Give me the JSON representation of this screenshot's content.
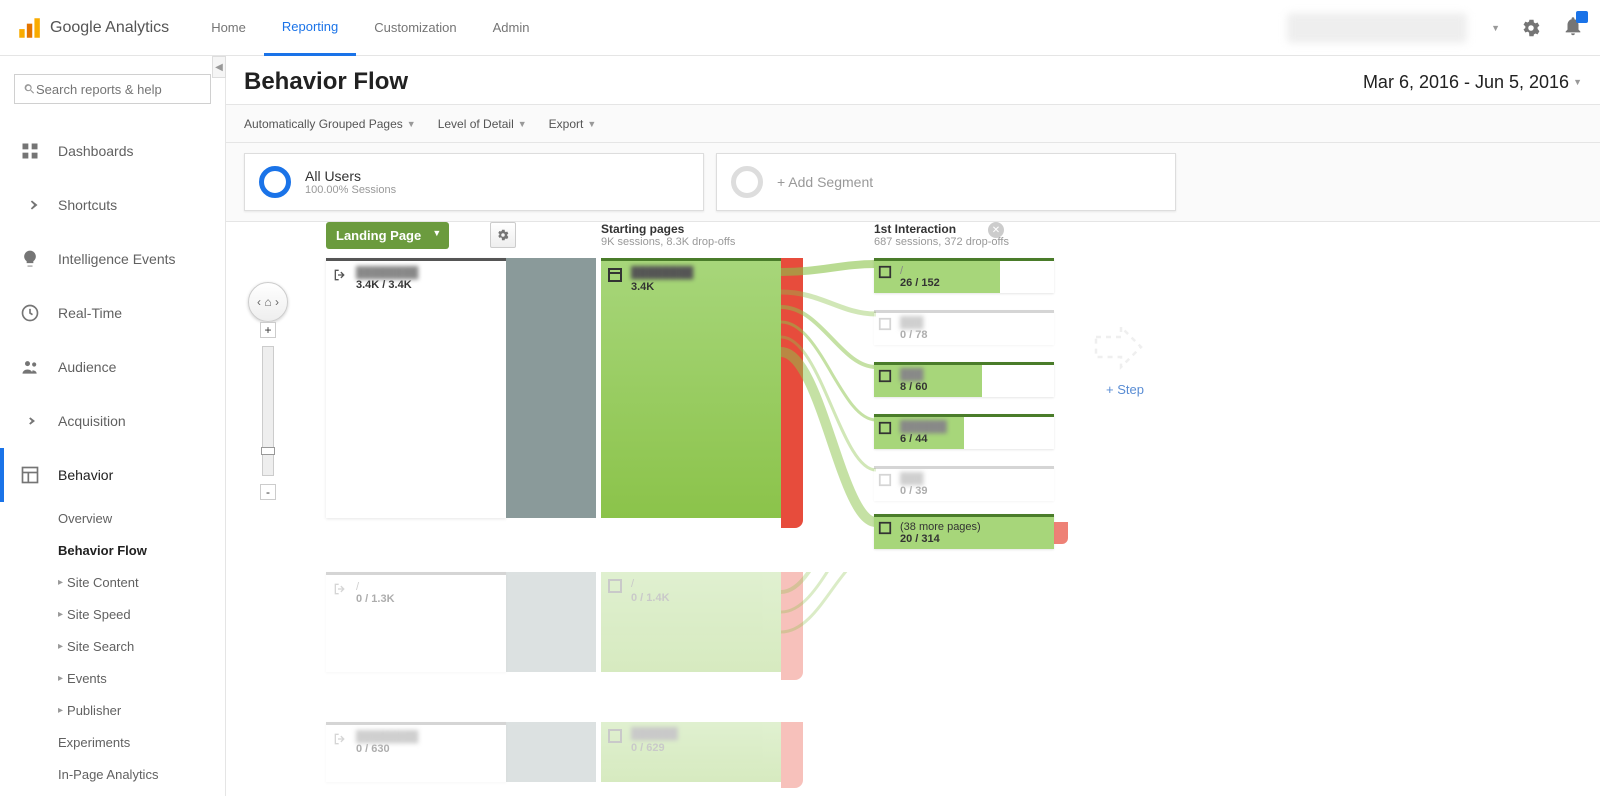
{
  "brand": "Google Analytics",
  "topnav": {
    "home": "Home",
    "reporting": "Reporting",
    "customization": "Customization",
    "admin": "Admin"
  },
  "search": {
    "placeholder": "Search reports & help"
  },
  "sidebar": {
    "dashboards": "Dashboards",
    "shortcuts": "Shortcuts",
    "intelligence": "Intelligence Events",
    "realtime": "Real-Time",
    "audience": "Audience",
    "acquisition": "Acquisition",
    "behavior": "Behavior",
    "sub": {
      "overview": "Overview",
      "behavior_flow": "Behavior Flow",
      "site_content": "Site Content",
      "site_speed": "Site Speed",
      "site_search": "Site Search",
      "events": "Events",
      "publisher": "Publisher",
      "experiments": "Experiments",
      "inpage": "In-Page Analytics"
    }
  },
  "page_title": "Behavior Flow",
  "date_range": "Mar 6, 2016 - Jun 5, 2016",
  "toolbar": {
    "grouped": "Automatically Grouped Pages",
    "detail": "Level of Detail",
    "export": "Export"
  },
  "segments": {
    "all_users": "All Users",
    "all_users_sub": "100.00% Sessions",
    "add": "+ Add Segment"
  },
  "flow": {
    "landing_label": "Landing Page",
    "starting_title": "Starting pages",
    "starting_sub": "9K sessions, 8.3K drop-offs",
    "interaction_title": "1st Interaction",
    "interaction_sub": "687 sessions, 372 drop-offs",
    "add_step": "+ Step",
    "landing_nodes": [
      {
        "label": "",
        "stats": "3.4K / 3.4K"
      },
      {
        "label": "/",
        "stats": "0 / 1.3K"
      },
      {
        "label": "",
        "stats": "0 / 630"
      }
    ],
    "starting_nodes": [
      {
        "label": "",
        "stats": "3.4K"
      },
      {
        "label": "/",
        "stats": "0 / 1.4K"
      },
      {
        "label": "",
        "stats": "0 / 629"
      }
    ],
    "interaction_nodes": [
      {
        "label": "/",
        "stats": "26 / 152"
      },
      {
        "label": "",
        "stats": "0 / 78"
      },
      {
        "label": "",
        "stats": "8 / 60"
      },
      {
        "label": "",
        "stats": "6 / 44"
      },
      {
        "label": "",
        "stats": "0 / 39"
      },
      {
        "label": "(38 more pages)",
        "stats": "20 / 314"
      }
    ]
  }
}
